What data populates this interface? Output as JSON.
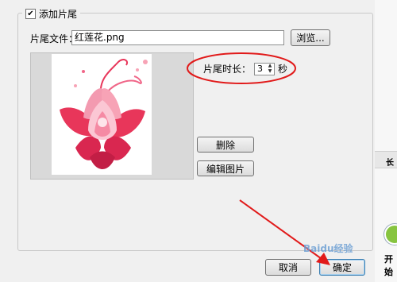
{
  "dialog": {
    "group_title": "添加片尾",
    "group_checked": true,
    "file_label": "片尾文件：",
    "file_value": "红莲花.png",
    "browse_button": "浏览...",
    "duration_label": "片尾时长：",
    "duration_value": "3",
    "duration_unit": "秒",
    "delete_button": "删除",
    "edit_button": "编辑图片",
    "cancel_button": "取消",
    "ok_button": "确定"
  },
  "right_panel": {
    "header_text": "长",
    "start_label": "开始"
  },
  "watermark": {
    "text": "Baidu经验"
  },
  "colors": {
    "annotation": "#e11a1a",
    "lotus_main": "#e8365a",
    "lotus_light": "#f7a3b6"
  }
}
